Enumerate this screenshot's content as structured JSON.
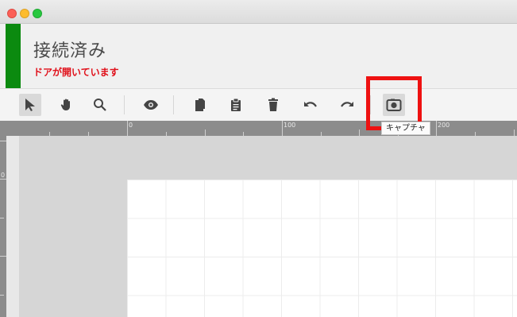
{
  "window": {
    "controls": [
      "close",
      "minimize",
      "zoom"
    ]
  },
  "status": {
    "title": "接続済み",
    "warning": "ドアが開いています",
    "indicator_color": "#0b8a0f",
    "warning_color": "#e0101a"
  },
  "toolbar": {
    "tools": [
      {
        "name": "select",
        "icon": "pointer-arrow-icon",
        "active": true
      },
      {
        "name": "pan",
        "icon": "hand-icon",
        "active": false
      },
      {
        "name": "zoom",
        "icon": "magnifier-icon",
        "active": false
      },
      {
        "name": "preview",
        "icon": "eye-icon",
        "active": false
      },
      {
        "name": "copy",
        "icon": "copy-icon",
        "active": false
      },
      {
        "name": "paste",
        "icon": "clipboard-icon",
        "active": false
      },
      {
        "name": "delete",
        "icon": "trash-icon",
        "active": false
      },
      {
        "name": "undo",
        "icon": "undo-icon",
        "active": false
      },
      {
        "name": "redo",
        "icon": "redo-icon",
        "active": false
      },
      {
        "name": "capture",
        "icon": "camera-icon",
        "active": true
      }
    ],
    "tooltip": "キャプチャ",
    "highlight_color": "#ee1111"
  },
  "ruler": {
    "top_labels": [
      "0",
      "100",
      "200"
    ],
    "left_labels": [
      "0"
    ]
  }
}
